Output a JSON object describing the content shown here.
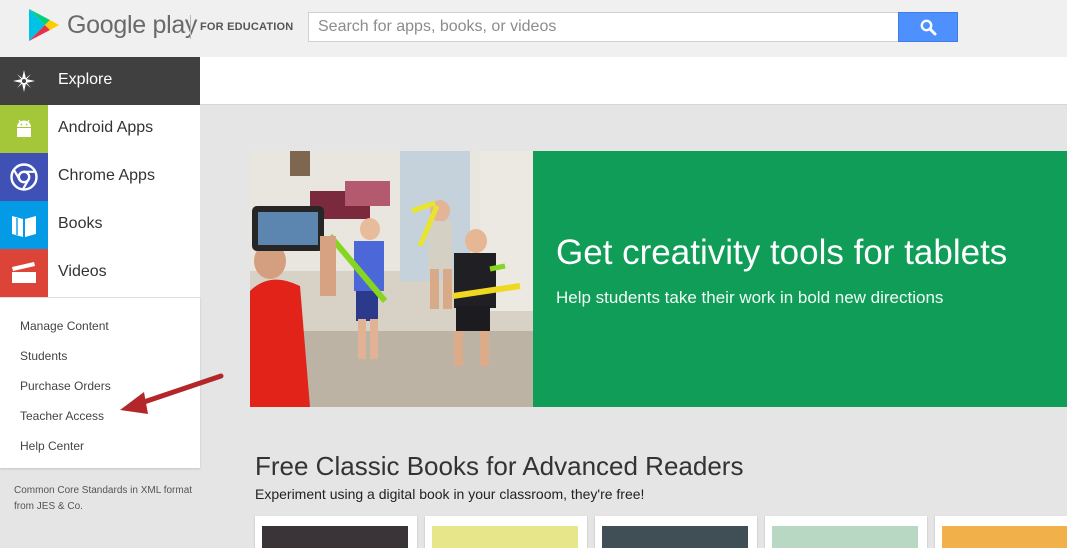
{
  "header": {
    "brand": "Google play",
    "subbrand": "FOR EDUCATION",
    "search_placeholder": "Search for apps, books, or videos"
  },
  "sidebar": {
    "nav": [
      {
        "label": "Explore",
        "icon": "compass-icon",
        "color": "#404040"
      },
      {
        "label": "Android Apps",
        "icon": "android-icon",
        "color": "#a4c639"
      },
      {
        "label": "Chrome Apps",
        "icon": "chrome-icon",
        "color": "#3f51b5"
      },
      {
        "label": "Books",
        "icon": "book-icon",
        "color": "#039be5"
      },
      {
        "label": "Videos",
        "icon": "clapper-icon",
        "color": "#db4437"
      }
    ],
    "links": [
      "Manage Content",
      "Students",
      "Purchase Orders",
      "Teacher Access",
      "Help Center"
    ],
    "footer_line1": "Common Core Standards in XML format",
    "footer_line2": "from JES & Co."
  },
  "banner": {
    "title": "Get creativity tools for tablets",
    "subtitle": "Help students take their work in bold new directions",
    "color": "#0f9d58"
  },
  "section": {
    "title": "Free Classic Books for Advanced Readers",
    "subtitle": "Experiment using a digital book in your classroom, they're free!",
    "cover_colors": [
      "#3a3438",
      "#e8e68a",
      "#3f4f55",
      "#b8d8c4",
      "#f2b04a"
    ]
  },
  "annotation": {
    "arrow_color": "#b3262a"
  }
}
